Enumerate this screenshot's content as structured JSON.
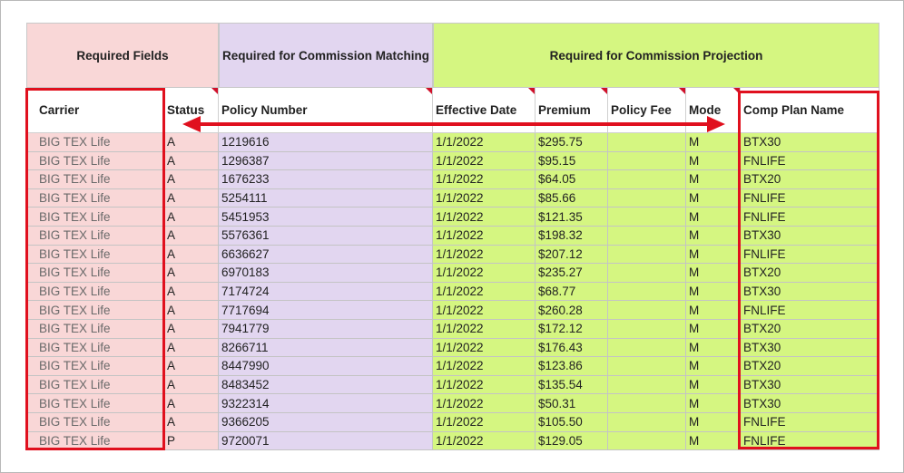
{
  "groups": {
    "required_fields": "Required Fields",
    "commission_matching": "Required for Commission Matching",
    "commission_projection": "Required for Commission Projection"
  },
  "columns": {
    "carrier": "Carrier",
    "status": "Status",
    "policy_number": "Policy Number",
    "effective_date": "Effective Date",
    "premium": "Premium",
    "policy_fee": "Policy Fee",
    "mode": "Mode",
    "comp_plan": "Comp Plan Name"
  },
  "rows": [
    {
      "carrier": "BIG TEX Life",
      "status": "A",
      "policy": "1219616",
      "date": "1/1/2022",
      "premium": "$295.75",
      "fee": "",
      "mode": "M",
      "plan": "BTX30"
    },
    {
      "carrier": "BIG TEX Life",
      "status": "A",
      "policy": "1296387",
      "date": "1/1/2022",
      "premium": "$95.15",
      "fee": "",
      "mode": "M",
      "plan": "FNLIFE"
    },
    {
      "carrier": "BIG TEX Life",
      "status": "A",
      "policy": "1676233",
      "date": "1/1/2022",
      "premium": "$64.05",
      "fee": "",
      "mode": "M",
      "plan": "BTX20"
    },
    {
      "carrier": "BIG TEX Life",
      "status": "A",
      "policy": "5254111",
      "date": "1/1/2022",
      "premium": "$85.66",
      "fee": "",
      "mode": "M",
      "plan": "FNLIFE"
    },
    {
      "carrier": "BIG TEX Life",
      "status": "A",
      "policy": "5451953",
      "date": "1/1/2022",
      "premium": "$121.35",
      "fee": "",
      "mode": "M",
      "plan": "FNLIFE"
    },
    {
      "carrier": "BIG TEX Life",
      "status": "A",
      "policy": "5576361",
      "date": "1/1/2022",
      "premium": "$198.32",
      "fee": "",
      "mode": "M",
      "plan": "BTX30"
    },
    {
      "carrier": "BIG TEX Life",
      "status": "A",
      "policy": "6636627",
      "date": "1/1/2022",
      "premium": "$207.12",
      "fee": "",
      "mode": "M",
      "plan": "FNLIFE"
    },
    {
      "carrier": "BIG TEX Life",
      "status": "A",
      "policy": "6970183",
      "date": "1/1/2022",
      "premium": "$235.27",
      "fee": "",
      "mode": "M",
      "plan": "BTX20"
    },
    {
      "carrier": "BIG TEX Life",
      "status": "A",
      "policy": "7174724",
      "date": "1/1/2022",
      "premium": "$68.77",
      "fee": "",
      "mode": "M",
      "plan": "BTX30"
    },
    {
      "carrier": "BIG TEX Life",
      "status": "A",
      "policy": "7717694",
      "date": "1/1/2022",
      "premium": "$260.28",
      "fee": "",
      "mode": "M",
      "plan": "FNLIFE"
    },
    {
      "carrier": "BIG TEX Life",
      "status": "A",
      "policy": "7941779",
      "date": "1/1/2022",
      "premium": "$172.12",
      "fee": "",
      "mode": "M",
      "plan": "BTX20"
    },
    {
      "carrier": "BIG TEX Life",
      "status": "A",
      "policy": "8266711",
      "date": "1/1/2022",
      "premium": "$176.43",
      "fee": "",
      "mode": "M",
      "plan": "BTX30"
    },
    {
      "carrier": "BIG TEX Life",
      "status": "A",
      "policy": "8447990",
      "date": "1/1/2022",
      "premium": "$123.86",
      "fee": "",
      "mode": "M",
      "plan": "BTX20"
    },
    {
      "carrier": "BIG TEX Life",
      "status": "A",
      "policy": "8483452",
      "date": "1/1/2022",
      "premium": "$135.54",
      "fee": "",
      "mode": "M",
      "plan": "BTX30"
    },
    {
      "carrier": "BIG TEX Life",
      "status": "A",
      "policy": "9322314",
      "date": "1/1/2022",
      "premium": "$50.31",
      "fee": "",
      "mode": "M",
      "plan": "BTX30"
    },
    {
      "carrier": "BIG TEX Life",
      "status": "A",
      "policy": "9366205",
      "date": "1/1/2022",
      "premium": "$105.50",
      "fee": "",
      "mode": "M",
      "plan": "FNLIFE"
    },
    {
      "carrier": "BIG TEX Life",
      "status": "P",
      "policy": "9720071",
      "date": "1/1/2022",
      "premium": "$129.05",
      "fee": "",
      "mode": "M",
      "plan": "FNLIFE"
    }
  ],
  "colors": {
    "required": "#f9d7d7",
    "matching": "#e2d6f0",
    "projection": "#d5f681",
    "highlight": "#e0101e"
  },
  "icons": [
    "double-arrow-icon",
    "required-marker-icon"
  ]
}
